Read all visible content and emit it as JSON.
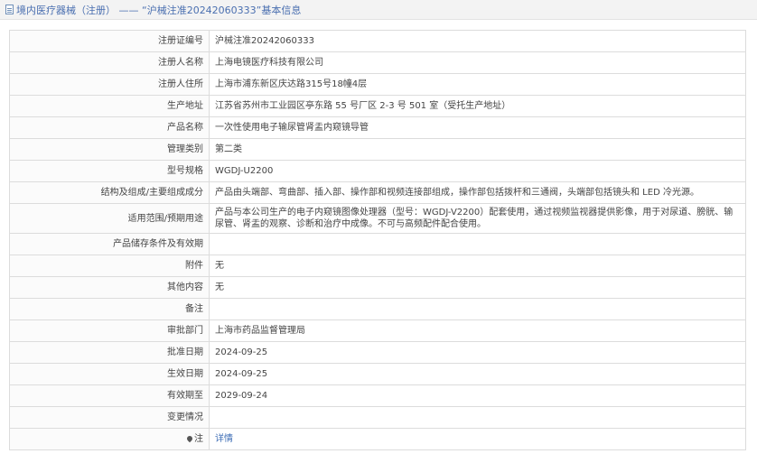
{
  "header": {
    "title": "境内医疗器械（注册） —— “沪械注准20242060333”基本信息"
  },
  "rows": [
    {
      "label": "注册证编号",
      "value": "沪械注准20242060333"
    },
    {
      "label": "注册人名称",
      "value": "上海电镜医疗科技有限公司"
    },
    {
      "label": "注册人住所",
      "value": "上海市浦东新区庆达路315号18幢4层"
    },
    {
      "label": "生产地址",
      "value": "江苏省苏州市工业园区亭东路 55 号厂区 2-3 号 501 室（受托生产地址）"
    },
    {
      "label": "产品名称",
      "value": "一次性使用电子输尿管肾盂内窥镜导管"
    },
    {
      "label": "管理类别",
      "value": "第二类"
    },
    {
      "label": "型号规格",
      "value": "WGDJ-U2200"
    },
    {
      "label": "结构及组成/主要组成成分",
      "value": "产品由头端部、弯曲部、插入部、操作部和视频连接部组成，操作部包括拨杆和三通阀，头端部包括镜头和 LED 冷光源。"
    },
    {
      "label": "适用范围/预期用途",
      "value": "产品与本公司生产的电子内窥镜图像处理器（型号：WGDJ-V2200）配套使用，通过视频监视器提供影像，用于对尿道、膀胱、输尿管、肾盂的观察、诊断和治疗中成像。不可与高频配件配合使用。"
    },
    {
      "label": "产品储存条件及有效期",
      "value": ""
    },
    {
      "label": "附件",
      "value": "无"
    },
    {
      "label": "其他内容",
      "value": "无"
    },
    {
      "label": "备注",
      "value": ""
    },
    {
      "label": "审批部门",
      "value": "上海市药品监督管理局"
    },
    {
      "label": "批准日期",
      "value": "2024-09-25"
    },
    {
      "label": "生效日期",
      "value": "2024-09-25"
    },
    {
      "label": "有效期至",
      "value": "2029-09-24"
    },
    {
      "label": "变更情况",
      "value": ""
    }
  ],
  "note": {
    "label": "注",
    "icon": "pin-icon",
    "link": "详情"
  }
}
